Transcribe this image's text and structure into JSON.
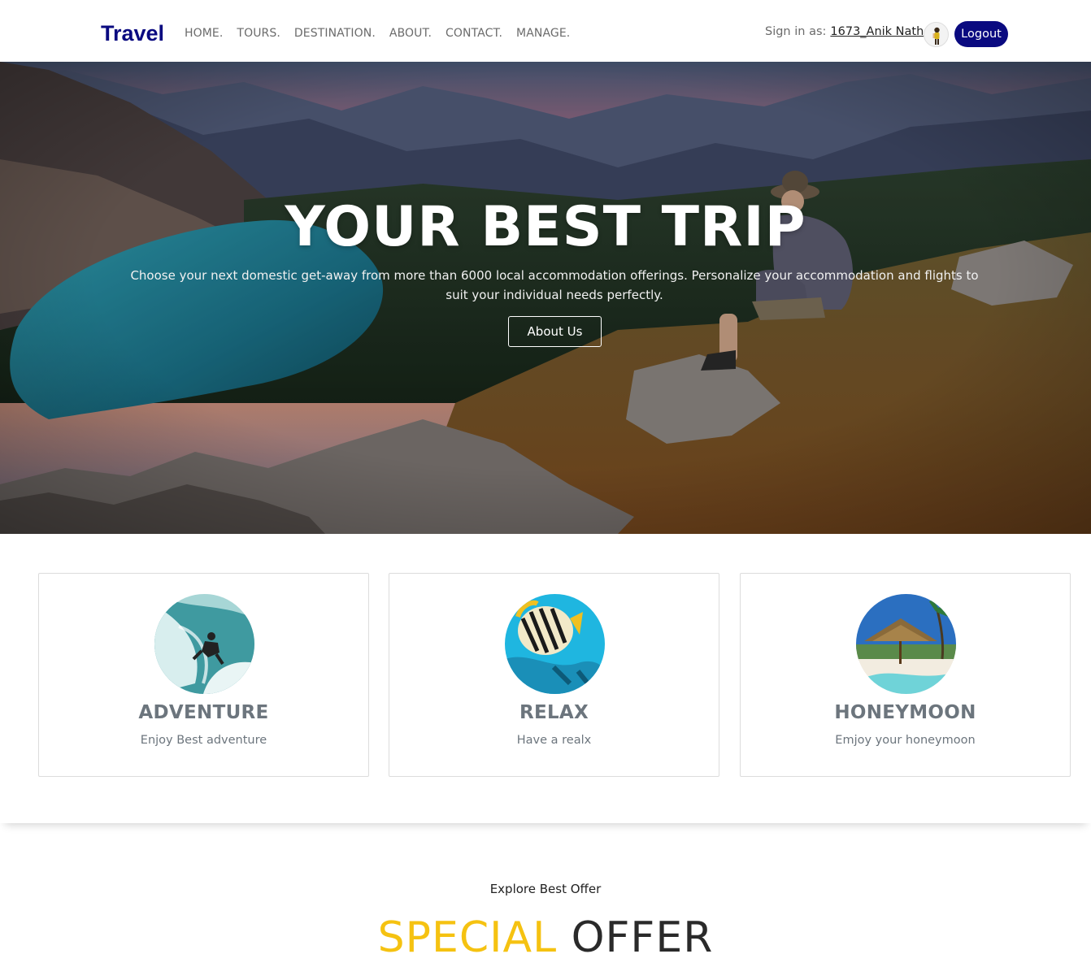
{
  "navbar": {
    "brand": "Travel",
    "links": [
      "HOME.",
      "TOURS.",
      "DESTINATION.",
      "ABOUT.",
      "CONTACT.",
      "MANAGE."
    ],
    "signin_label": "Sign in as:",
    "signin_user": "1673_Anik Nath",
    "logout_label": "Logout",
    "brand_color": "#0a0a80"
  },
  "hero": {
    "title": "YOUR BEST TRIP",
    "description": "Choose your next domestic get-away from more than 6000 local accommodation offerings. Personalize your accommodation and flights to suit your individual needs perfectly.",
    "button_label": "About Us"
  },
  "cards": [
    {
      "title": "ADVENTURE",
      "subtitle": "Enjoy Best adventure",
      "icon": "surfer-image"
    },
    {
      "title": "RELAX",
      "subtitle": "Have a realx",
      "icon": "fish-image"
    },
    {
      "title": "HONEYMOON",
      "subtitle": "Emjoy your honeymoon",
      "icon": "beach-hut-image"
    }
  ],
  "offer": {
    "eyebrow": "Explore Best Offer",
    "title_highlight": "SPECIAL",
    "title_rest": "OFFER",
    "highlight_color": "#f5c211"
  }
}
